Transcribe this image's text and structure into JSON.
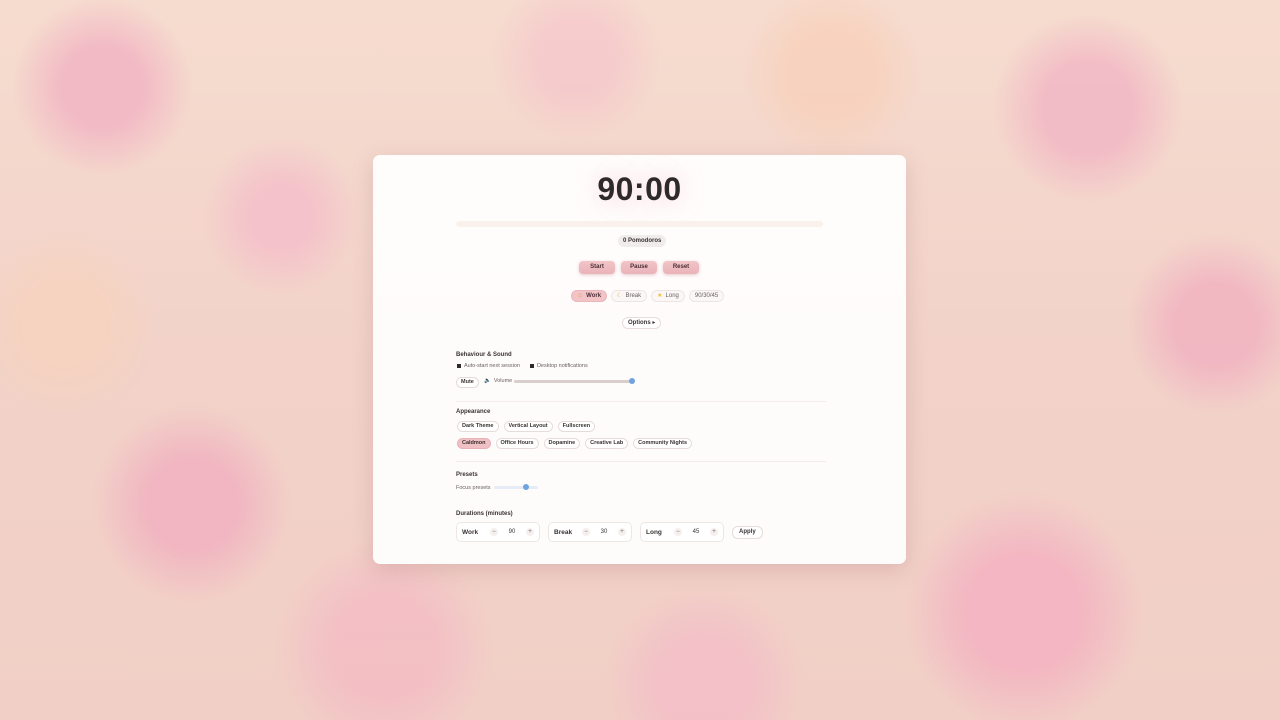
{
  "timer": {
    "display": "90:00",
    "progress": 0.0
  },
  "pomodoros": "0 Pomodoros",
  "controls": {
    "start": "Start",
    "pause": "Pause",
    "reset": "Reset"
  },
  "modes": [
    {
      "label": "Work",
      "icon": "sun-icon",
      "glyph": "☺",
      "active": true
    },
    {
      "label": "Break",
      "icon": "moon-icon",
      "glyph": "☾",
      "active": false
    },
    {
      "label": "Long",
      "icon": "star-icon",
      "glyph": "★",
      "active": false
    },
    {
      "label": "90/30/45",
      "icon": "",
      "glyph": "",
      "active": false
    }
  ],
  "options_label": "Options ▸",
  "behaviour": {
    "title": "Behaviour & Sound",
    "auto_start": "Auto-start next session",
    "desktop_notifications": "Desktop notifications",
    "mute": "Mute",
    "volume_label": "Volume",
    "volume": 1.0
  },
  "appearance": {
    "title": "Appearance",
    "toggles": [
      "Dark Theme",
      "Vertical Layout",
      "Fullscreen"
    ],
    "themes": [
      {
        "label": "Caldmon",
        "active": true
      },
      {
        "label": "Office Hours",
        "active": false
      },
      {
        "label": "Dopamine",
        "active": false
      },
      {
        "label": "Creative Lab",
        "active": false
      },
      {
        "label": "Community Nights",
        "active": false
      }
    ]
  },
  "presets": {
    "title": "Presets",
    "label": "Focus presets",
    "level": 0.72
  },
  "durations": {
    "title": "Durations (minutes)",
    "work": {
      "label": "Work",
      "value": "90"
    },
    "break": {
      "label": "Break",
      "value": "30"
    },
    "long": {
      "label": "Long",
      "value": "45"
    },
    "apply": "Apply",
    "minus": "−",
    "plus": "+"
  },
  "colors": {
    "accent": "#f0c0c4",
    "slider": "#6ea3e0"
  }
}
